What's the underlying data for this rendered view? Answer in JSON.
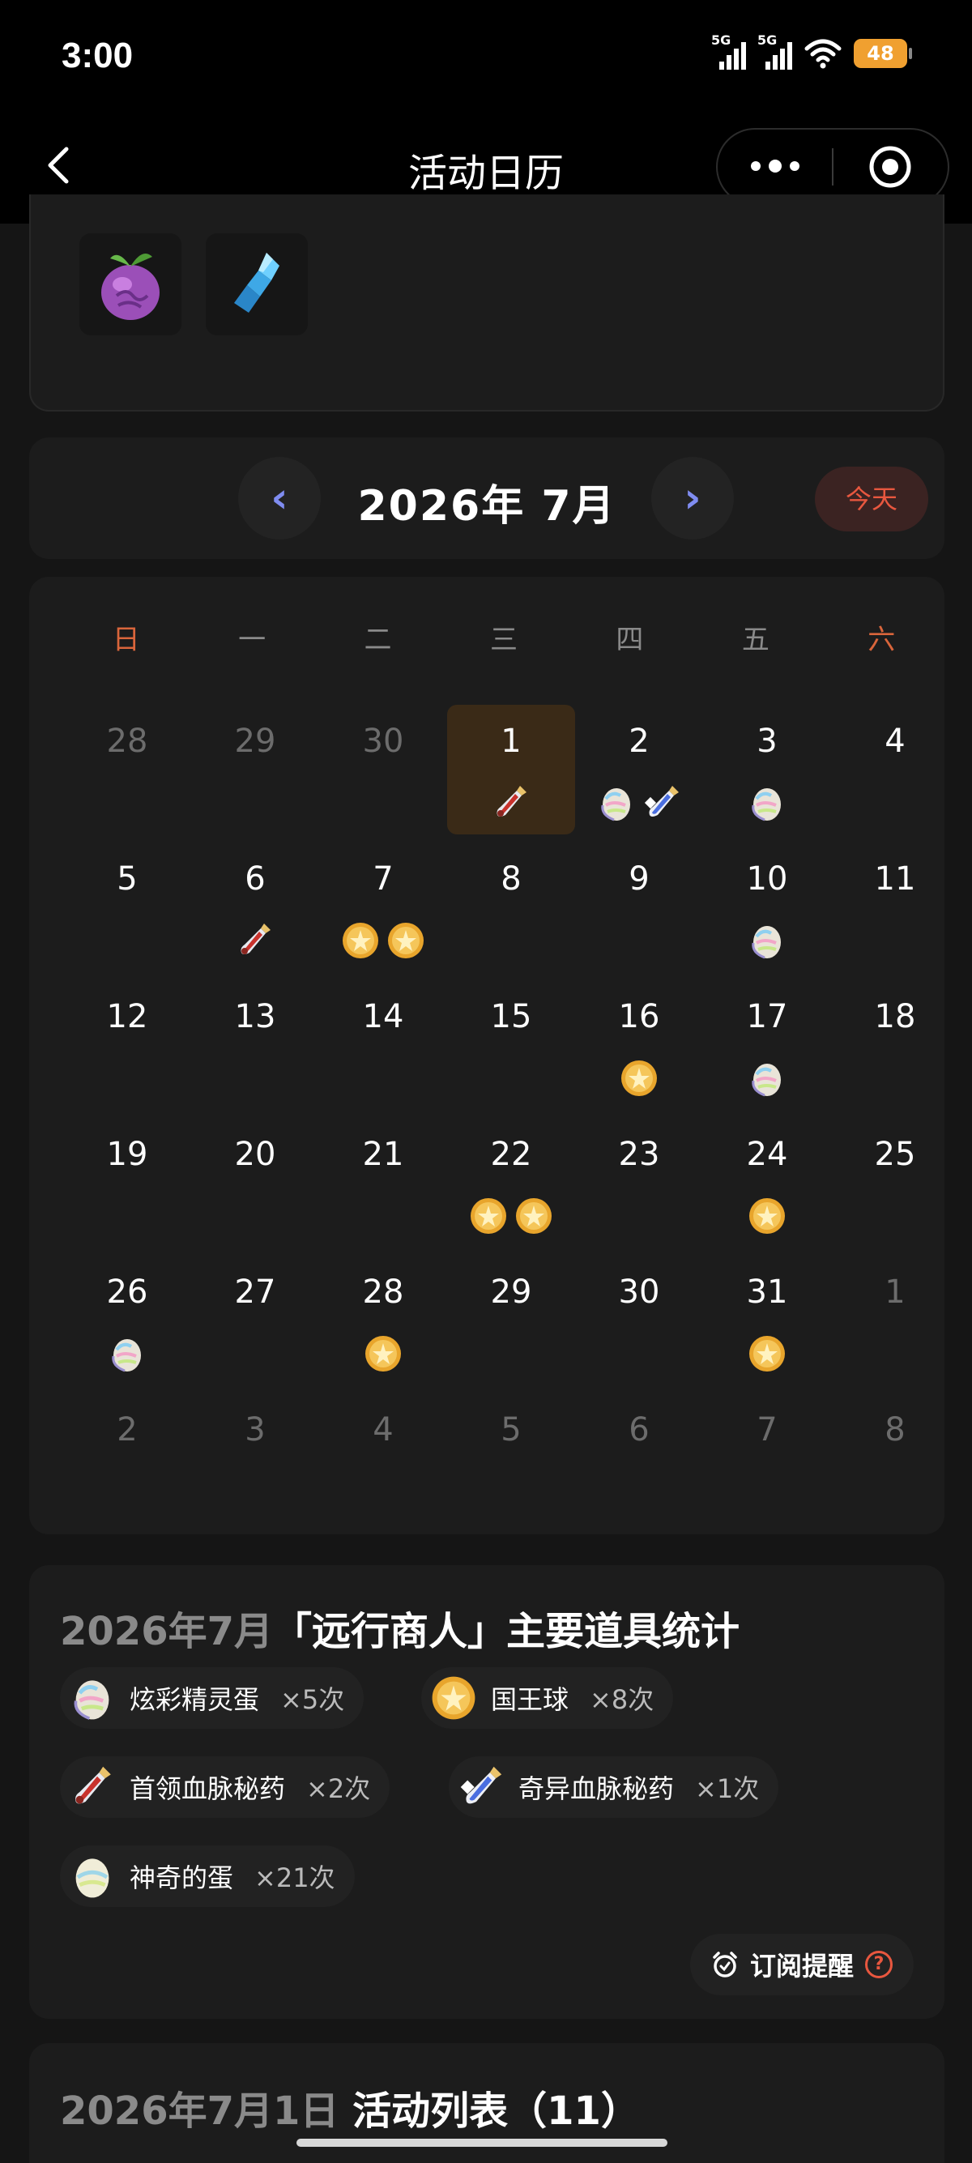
{
  "status": {
    "time": "3:00",
    "sig1": "5G",
    "sig2": "5G",
    "battery": "48"
  },
  "nav": {
    "title": "活动日历",
    "back_icon": "chevron-left-icon",
    "more_icon": "more-dots-icon",
    "target_icon": "target-icon"
  },
  "top_items": [
    "fruit-icon",
    "crystal-icon"
  ],
  "month": {
    "prev": "‹",
    "title": "2026年 7月",
    "next": "›",
    "today": "今天"
  },
  "weekdays": [
    "日",
    "一",
    "二",
    "三",
    "四",
    "五",
    "六"
  ],
  "weeks": [
    [
      {
        "d": "28",
        "m": true,
        "i": []
      },
      {
        "d": "29",
        "m": true,
        "i": []
      },
      {
        "d": "30",
        "m": true,
        "i": []
      },
      {
        "d": "1",
        "sel": true,
        "i": [
          "potion"
        ]
      },
      {
        "d": "2",
        "i": [
          "rainbow",
          "potion2"
        ]
      },
      {
        "d": "3",
        "i": [
          "rainbow"
        ]
      },
      {
        "d": "4",
        "i": []
      }
    ],
    [
      {
        "d": "5",
        "i": []
      },
      {
        "d": "6",
        "i": [
          "potion"
        ]
      },
      {
        "d": "7",
        "i": [
          "ball",
          "ball"
        ]
      },
      {
        "d": "8",
        "i": []
      },
      {
        "d": "9",
        "i": []
      },
      {
        "d": "10",
        "i": [
          "rainbow"
        ]
      },
      {
        "d": "11",
        "i": []
      }
    ],
    [
      {
        "d": "12",
        "i": []
      },
      {
        "d": "13",
        "i": []
      },
      {
        "d": "14",
        "i": []
      },
      {
        "d": "15",
        "i": []
      },
      {
        "d": "16",
        "i": [
          "ball"
        ]
      },
      {
        "d": "17",
        "i": [
          "rainbow"
        ]
      },
      {
        "d": "18",
        "i": []
      }
    ],
    [
      {
        "d": "19",
        "i": []
      },
      {
        "d": "20",
        "i": []
      },
      {
        "d": "21",
        "i": []
      },
      {
        "d": "22",
        "i": [
          "ball",
          "ball"
        ]
      },
      {
        "d": "23",
        "i": []
      },
      {
        "d": "24",
        "i": [
          "ball"
        ]
      },
      {
        "d": "25",
        "i": []
      }
    ],
    [
      {
        "d": "26",
        "i": [
          "rainbow"
        ]
      },
      {
        "d": "27",
        "i": []
      },
      {
        "d": "28",
        "i": [
          "ball"
        ]
      },
      {
        "d": "29",
        "i": []
      },
      {
        "d": "30",
        "i": []
      },
      {
        "d": "31",
        "i": [
          "ball"
        ]
      },
      {
        "d": "1",
        "m": true,
        "i": []
      }
    ],
    [
      {
        "d": "2",
        "m": true,
        "i": []
      },
      {
        "d": "3",
        "m": true,
        "i": []
      },
      {
        "d": "4",
        "m": true,
        "i": []
      },
      {
        "d": "5",
        "m": true,
        "i": []
      },
      {
        "d": "6",
        "m": true,
        "i": []
      },
      {
        "d": "7",
        "m": true,
        "i": []
      },
      {
        "d": "8",
        "m": true,
        "i": []
      }
    ]
  ],
  "stats": {
    "title_date": "2026年7月",
    "title_rest": "「远行商人」主要道具统计",
    "items": [
      {
        "icon": "rainbow",
        "name": "炫彩精灵蛋",
        "count": "×5次"
      },
      {
        "icon": "ball",
        "name": "国王球",
        "count": "×8次"
      },
      {
        "icon": "potion",
        "name": "首领血脉秘药",
        "count": "×2次"
      },
      {
        "icon": "potion2",
        "name": "奇异血脉秘药",
        "count": "×1次"
      },
      {
        "icon": "egg",
        "name": "神奇的蛋",
        "count": "×21次"
      }
    ],
    "subscribe": "订阅提醒",
    "help": "?"
  },
  "list": {
    "title_date": "2026年7月1日",
    "title_rest": " 活动列表（11）"
  }
}
